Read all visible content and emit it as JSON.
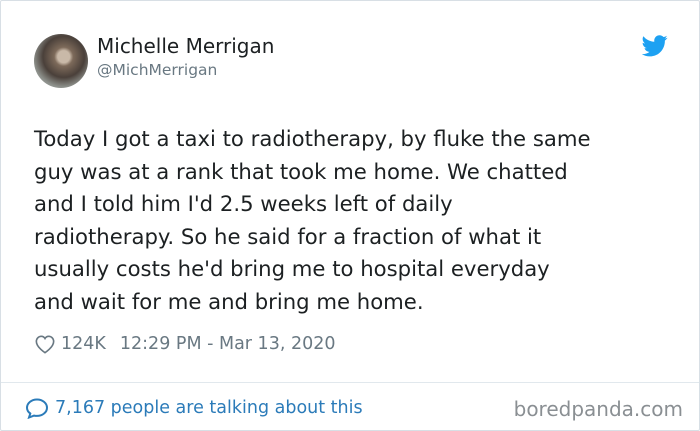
{
  "author": {
    "name": "Michelle Merrigan",
    "handle": "@MichMerrigan"
  },
  "tweet": {
    "text": "Today I got a taxi to radiotherapy, by fluke the same\nguy was at a rank that took me home. We chatted\nand I told him I'd 2.5 weeks left of daily\nradiotherapy. So he said for a fraction of what it\nusually costs he'd bring me to hospital everyday\nand wait for me and bring me home.",
    "likes": "124K",
    "timestamp": "12:29 PM - Mar 13, 2020"
  },
  "footer": {
    "talking": "7,167 people are talking about this",
    "watermark": "boredpanda.com"
  },
  "icons": {
    "brand": "twitter-bird-icon",
    "like": "heart-icon",
    "talk": "speech-bubble-icon"
  },
  "colors": {
    "twitter_blue": "#1da1f2",
    "link_blue": "#2b7bb9",
    "text": "#1c2022",
    "muted": "#697882"
  }
}
